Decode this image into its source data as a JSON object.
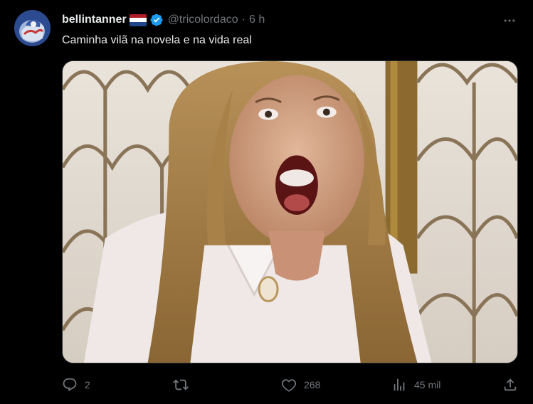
{
  "tweet": {
    "author_name": "bellintanner",
    "author_handle": "@tricolordaco",
    "separator": "·",
    "time": "6 h",
    "text": "Caminha vilã na novela e na vida real",
    "flag_colors": [
      "#ae1c28",
      "#ffffff",
      "#21468b"
    ],
    "verified_color": "#1d9bf0",
    "media_description_icon": "photo"
  },
  "actions": {
    "reply_count": "2",
    "retweet_count": "",
    "like_count": "268",
    "views_count": "45 mil"
  },
  "icons": {
    "more": "more-horizontal-icon",
    "reply": "reply-icon",
    "retweet": "retweet-icon",
    "like": "heart-icon",
    "views": "bar-chart-icon",
    "share": "share-icon"
  }
}
